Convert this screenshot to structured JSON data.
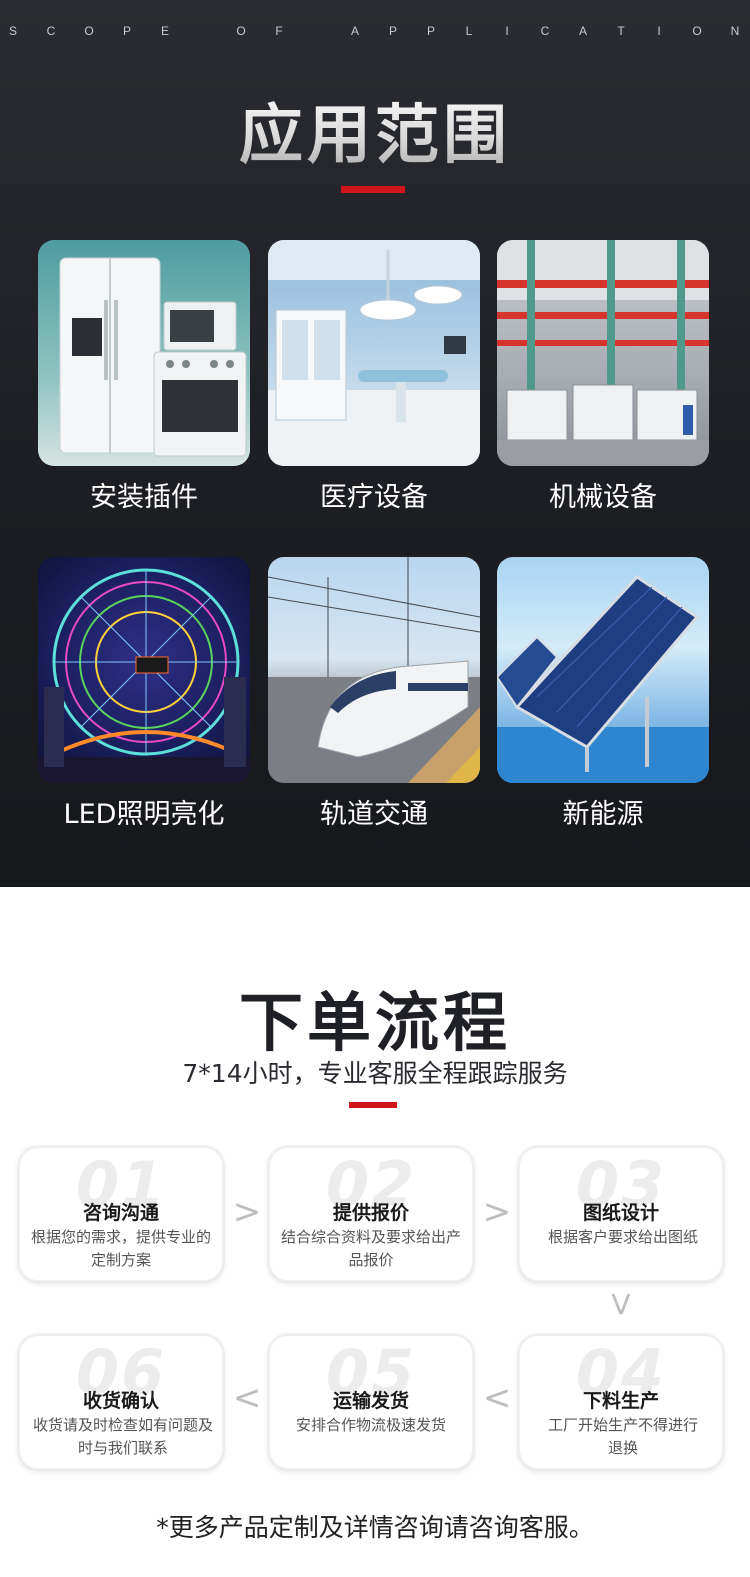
{
  "application": {
    "scope_letters": [
      "S",
      "C",
      "O",
      "P",
      "E",
      "",
      "O",
      "F",
      "",
      "A",
      "P",
      "P",
      "L",
      "I",
      "C",
      "A",
      "T",
      "I",
      "O",
      "N"
    ],
    "title": "应用范围",
    "items": [
      {
        "label": "安装插件",
        "icon": "home-appliances-image"
      },
      {
        "label": "医疗设备",
        "icon": "medical-room-image"
      },
      {
        "label": "机械设备",
        "icon": "factory-machinery-image"
      },
      {
        "label": "LED照明亮化",
        "icon": "ferris-wheel-image"
      },
      {
        "label": "轨道交通",
        "icon": "bullet-train-image"
      },
      {
        "label": "新能源",
        "icon": "solar-panel-image"
      }
    ]
  },
  "order": {
    "title": "下单流程",
    "subtitle": "7*14小时，专业客服全程跟踪服务",
    "steps": [
      {
        "num": "01",
        "title": "咨询沟通",
        "desc": "根据您的需求，提供专业的定制方案"
      },
      {
        "num": "02",
        "title": "提供报价",
        "desc": "结合综合资料及要求给出产品报价"
      },
      {
        "num": "03",
        "title": "图纸设计",
        "desc": "根据客户要求给出图纸"
      },
      {
        "num": "04",
        "title": "下料生产",
        "desc": "工厂开始生产不得进行退换"
      },
      {
        "num": "05",
        "title": "运输发货",
        "desc": "安排合作物流极速发货"
      },
      {
        "num": "06",
        "title": "收货确认",
        "desc": "收货请及时检查如有问题及时与我们联系"
      }
    ],
    "arrows": {
      "right": ">",
      "left": "<",
      "down": "V"
    }
  },
  "footer": {
    "note": "*更多产品定制及详情咨询请咨询客服。"
  },
  "colors": {
    "accent_red": "#d0141a",
    "dark_bg": "#1c1e23"
  }
}
